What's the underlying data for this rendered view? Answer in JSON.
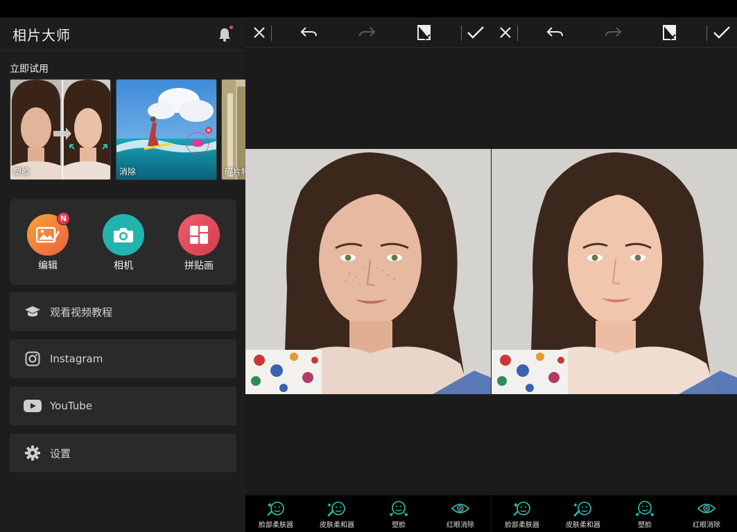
{
  "app": {
    "title": "相片大师"
  },
  "try_now": {
    "title": "立即试用",
    "cards": [
      {
        "label": "塑脸"
      },
      {
        "label": "消除"
      },
      {
        "label": "碎片特"
      }
    ]
  },
  "tools": [
    {
      "label": "编辑",
      "badge": "N",
      "color": "#f07a3c"
    },
    {
      "label": "相机",
      "color": "#23b3ad"
    },
    {
      "label": "拼贴画",
      "color": "#e54b5c"
    }
  ],
  "menu": [
    {
      "label": "观看视频教程",
      "icon": "graduation-cap-icon"
    },
    {
      "label": "Instagram",
      "icon": "instagram-icon"
    },
    {
      "label": "YouTube",
      "icon": "youtube-icon"
    },
    {
      "label": "设置",
      "icon": "gear-icon"
    }
  ],
  "editor": {
    "bottom_tools": [
      {
        "label": "脸部柔肤器",
        "icon": "face-sparkle-icon"
      },
      {
        "label": "皮肤柔和器",
        "icon": "face-brush-icon"
      },
      {
        "label": "塑脸",
        "icon": "face-reshape-icon"
      },
      {
        "label": "红眼消除",
        "icon": "eye-icon"
      }
    ]
  },
  "colors": {
    "accent": "#2ec4b6",
    "background": "#1b1b1b",
    "panel": "#2a2a2a"
  }
}
